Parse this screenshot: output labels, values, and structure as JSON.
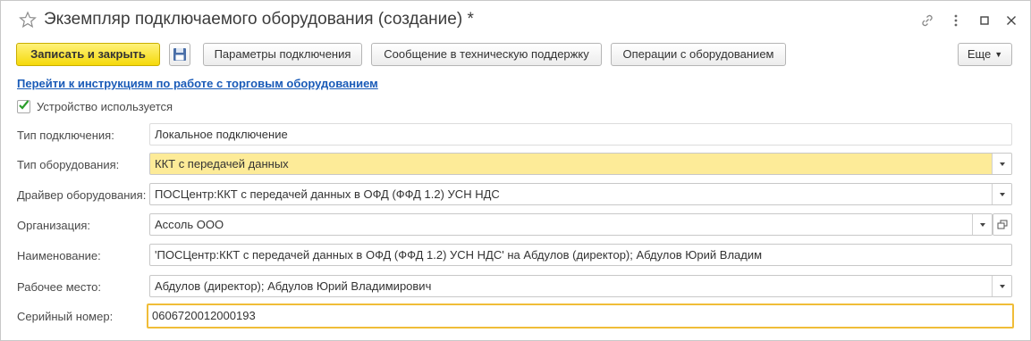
{
  "window": {
    "title": "Экземпляр подключаемого оборудования (создание) *"
  },
  "toolbar": {
    "save_close_label": "Записать и закрыть",
    "connection_params_label": "Параметры подключения",
    "support_message_label": "Сообщение в техническую поддержку",
    "equipment_operations_label": "Операции с оборудованием",
    "more_label": "Еще"
  },
  "instructions_link": "Перейти к инструкциям по работе с торговым оборудованием",
  "device_in_use": {
    "label": "Устройство используется",
    "checked": true
  },
  "form": {
    "connection_type": {
      "label": "Тип подключения:",
      "value": "Локальное подключение"
    },
    "equipment_type": {
      "label": "Тип оборудования:",
      "value": "ККТ с передачей данных"
    },
    "driver": {
      "label": "Драйвер оборудования:",
      "value": "ПОСЦентр:ККТ с передачей данных в ОФД (ФФД 1.2) УСН НДС"
    },
    "organization": {
      "label": "Организация:",
      "value": "Ассоль ООО"
    },
    "name": {
      "label": "Наименование:",
      "value": "'ПОСЦентр:ККТ с передачей данных в ОФД (ФФД 1.2) УСН НДС' на Абдулов (директор); Абдулов Юрий Владим"
    },
    "workplace": {
      "label": "Рабочее место:",
      "value": "Абдулов (директор); Абдулов Юрий Владимирович"
    },
    "serial_number": {
      "label": "Серийный номер:",
      "value": "0606720012000193"
    }
  },
  "colors": {
    "primary_button": "#f5d90a",
    "link": "#1a5bb8",
    "highlight_field": "#fdeb98",
    "focus_border": "#f0bd38",
    "checkmark": "#2a9d2a"
  }
}
